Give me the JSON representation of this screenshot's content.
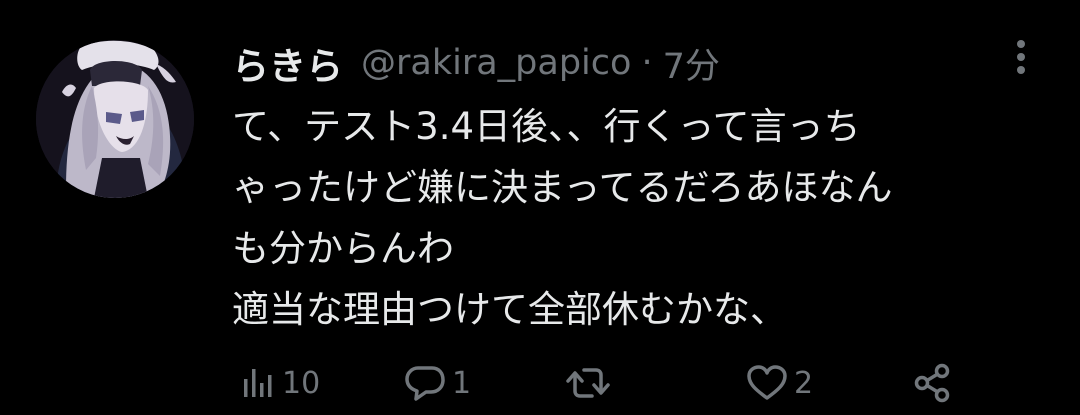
{
  "tweet": {
    "display_name": "らきら",
    "handle": "@rakira_papico",
    "separator": "·",
    "time": "7分",
    "text_lines": [
      "て、テスト3.4日後、、行くって言っち",
      "ゃったけど嫌に決まってるだろあほなん",
      "も分からんわ",
      "適当な理由つけて全部休むかな、"
    ]
  },
  "actions": {
    "views": {
      "icon": "bar-chart-icon",
      "count": "10"
    },
    "reply": {
      "icon": "speech-bubble-icon",
      "count": "1"
    },
    "retweet": {
      "icon": "retweet-icon",
      "count": ""
    },
    "like": {
      "icon": "heart-icon",
      "count": "2"
    },
    "share": {
      "icon": "share-icon"
    }
  },
  "colors": {
    "background": "#000000",
    "primary_text": "#e7e9ea",
    "secondary_text": "#71767b"
  }
}
